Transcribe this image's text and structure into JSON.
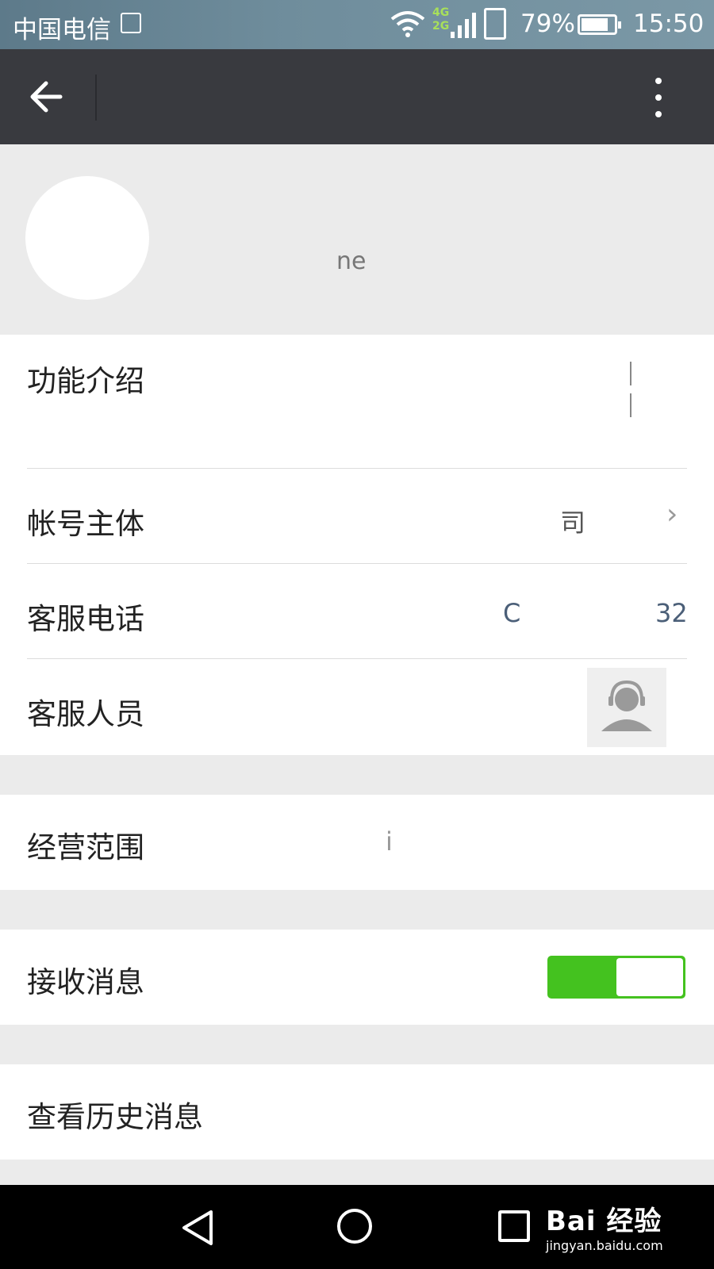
{
  "status_bar": {
    "carrier": "中国电信",
    "network_top": "4G",
    "network_bottom": "2G",
    "battery": "79%",
    "time": "15:50"
  },
  "header": {
    "title": ""
  },
  "profile": {
    "subtitle": "ne"
  },
  "info": {
    "intro_label": "功能介绍",
    "account_label": "帐号主体",
    "account_value": "司",
    "phone_label": "客服电话",
    "phone_value_start": "C",
    "phone_value_end": "32",
    "agent_label": "客服人员"
  },
  "business": {
    "label": "经营范围",
    "value": "i"
  },
  "messages": {
    "receive_label": "接收消息",
    "receive_enabled": true
  },
  "history": {
    "label": "查看历史消息"
  },
  "watermark": {
    "main": "Bai 经验",
    "sub": "jingyan.baidu.com"
  },
  "colors": {
    "header_bg": "#393a3f",
    "toggle_on": "#44c21f",
    "link_text": "#4b5f78"
  }
}
